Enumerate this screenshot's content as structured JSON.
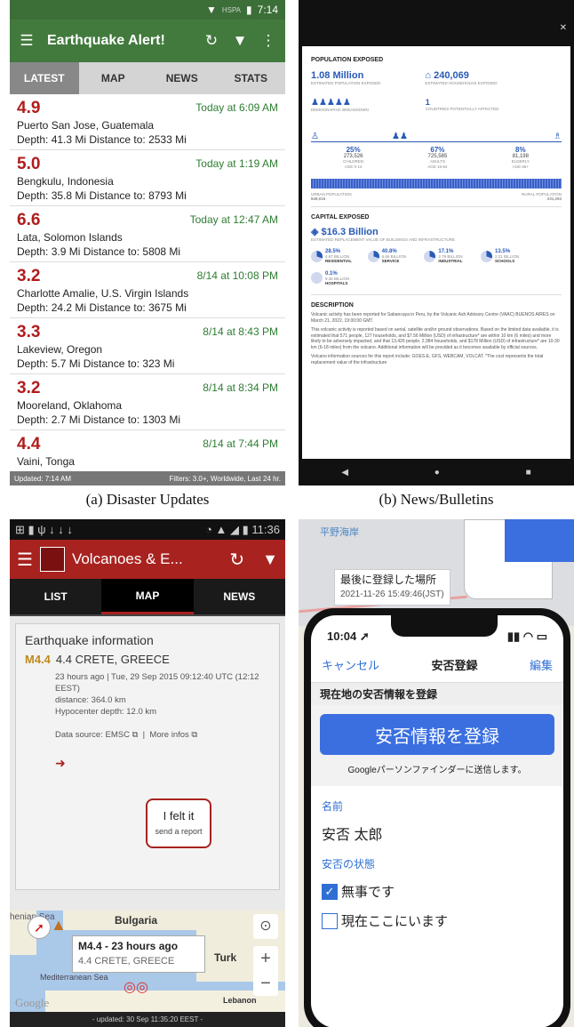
{
  "captions": {
    "a": "(a) Disaster Updates",
    "b": "(b) News/Bulletins"
  },
  "a": {
    "status_time": "7:14",
    "status_net": "HSPA",
    "app_title": "Earthquake Alert!",
    "tabs": [
      "LATEST",
      "MAP",
      "NEWS",
      "STATS"
    ],
    "quakes": [
      {
        "mag": "4.9",
        "when": "Today at 6:09 AM",
        "place": "Puerto San Jose, Guatemala",
        "detail": "Depth: 41.3 Mi   Distance to: 2533 Mi"
      },
      {
        "mag": "5.0",
        "when": "Today at 1:19 AM",
        "place": "Bengkulu, Indonesia",
        "detail": "Depth: 35.8 Mi   Distance to: 8793 Mi"
      },
      {
        "mag": "6.6",
        "when": "Today at 12:47 AM",
        "place": "Lata, Solomon Islands",
        "detail": "Depth: 3.9 Mi   Distance to: 5808 Mi"
      },
      {
        "mag": "3.2",
        "when": "8/14 at 10:08 PM",
        "place": "Charlotte Amalie, U.S. Virgin Islands",
        "detail": "Depth: 24.2 Mi   Distance to: 3675 Mi"
      },
      {
        "mag": "3.3",
        "when": "8/14 at 8:43 PM",
        "place": "Lakeview, Oregon",
        "detail": "Depth: 5.7 Mi   Distance to: 323 Mi"
      },
      {
        "mag": "3.2",
        "when": "8/14 at 8:34 PM",
        "place": "Mooreland, Oklahoma",
        "detail": "Depth: 2.7 Mi   Distance to: 1303 Mi"
      },
      {
        "mag": "4.4",
        "when": "8/14 at 7:44 PM",
        "place": "Vaini, Tonga",
        "detail": ""
      }
    ],
    "footer_left": "Updated: 7:14 AM",
    "footer_right": "Filters: 3.0+, Worldwide, Last 24 hr."
  },
  "b": {
    "pop_h": "POPULATION EXPOSED",
    "pop_big": "1.08 Million",
    "pop_big_sub": "ESTIMATED POPULATION EXPOSED",
    "house_big": "240,069",
    "house_sub": "ESTIMATED HOUSEHOLDS EXPOSED",
    "demo": "DEMOGRAPHIC BREAKDOWN",
    "countries": "1",
    "countries_sub": "COUNTRIES POTENTIALLY AFFECTED",
    "age_groups": [
      {
        "pct": "25%",
        "n": "273,526",
        "l1": "CHILDREN",
        "l2": "AGE 0-14"
      },
      {
        "pct": "67%",
        "n": "725,585",
        "l1": "ADULTS",
        "l2": "AGE 15-64"
      },
      {
        "pct": "8%",
        "n": "81,198",
        "l1": "ELDERLY",
        "l2": "AGE 65+"
      }
    ],
    "urban": "URBAN POPULATION",
    "urban_n": "849,016",
    "rural": "RURAL POPULATION",
    "rural_n": "231,293",
    "cap_h": "CAPITAL EXPOSED",
    "cap_big": "$16.3 Billion",
    "cap_sub": "ESTIMATED REPLACEMENT VALUE OF BUILDINGS AND INFRASTRUCTURE",
    "sectors": [
      {
        "pct": "28.5%",
        "v": "4.67 BILLION",
        "l": "RESIDENTIAL"
      },
      {
        "pct": "40.8%",
        "v": "6.66 BILLION",
        "l": "SERVICE"
      },
      {
        "pct": "17.1%",
        "v": "2.79 BILLION",
        "l": "INDUSTRIAL"
      },
      {
        "pct": "13.5%",
        "v": "2.21 BILLION",
        "l": "SCHOOLS"
      },
      {
        "pct": "0.1%",
        "v": "9.36 BILLION",
        "l": "HOSPITALS"
      }
    ],
    "desc_h": "DESCRIPTION",
    "desc_1": "Volcanic activity has been reported for Sabancaya in Peru, by the Volcanic Ash Advisory Centre (VAAC) BUENOS AIRES on March 21, 2022, 19:00:00 GMT.",
    "desc_2": "This volcanic activity is reported based on aerial, satellite and/or ground observations. Based on the limited data available, it is estimated that 571 people, 127 households, and $7.56 Million (USD) of infrastructure* are within 10 km (6 miles) and more likely to be adversely impacted, and that 13,426 people, 2,984 households, and $178 Million (USD) of infrastructure* are 10-30 km (6-18 miles) from the volcano. Additional information will be provided as it becomes available by official sources.",
    "desc_3": "Volcano information sources for this report include: GOES-E, GFS, WEBCAM, VOLCAT. *The cost represents the total replacement value of the infrastructure"
  },
  "c": {
    "status_time": "11:36",
    "app_title": "Volcanoes & E...",
    "tabs": [
      "LIST",
      "MAP",
      "NEWS"
    ],
    "card_h": "Earthquake information",
    "mag_tag": "M4.4",
    "mag_place": "4.4  CRETE, GREECE",
    "d1": "23 hours ago | Tue, 29 Sep 2015 09:12:40 UTC (12:12 EEST)",
    "d2": "distance: 364.0 km",
    "d3": "Hypocenter depth: 12.0 km",
    "src": "Data source: EMSC",
    "more": "More infos",
    "felt": "I felt it",
    "felt_sub": "send a report",
    "map_bulgaria": "Bulgaria",
    "map_med": "Mediterranean Sea",
    "map_turkey": "Turk",
    "map_lebanon": "Lebanon",
    "map_sea": "henian Sea",
    "map_google": "Google",
    "pop_t": "M4.4 - 23 hours ago",
    "pop_s": "4.4 CRETE, GREECE",
    "footer": "- updated: 30 Sep 11:35:20 EEST -"
  },
  "d": {
    "map_place": "平野海岸",
    "label_t": "最後に登録した場所",
    "label_s": "2021-11-26 15:49:46(JST)",
    "time": "10:04",
    "cancel": "キャンセル",
    "title": "安否登録",
    "edit": "編集",
    "section": "現在地の安否情報を登録",
    "button": "安否情報を登録",
    "note": "Googleパーソンファインダーに送信します。",
    "name_l": "名前",
    "name_v": "安否 太郎",
    "status_l": "安否の状態",
    "opt1": "無事です",
    "opt2": "現在ここにいます"
  }
}
